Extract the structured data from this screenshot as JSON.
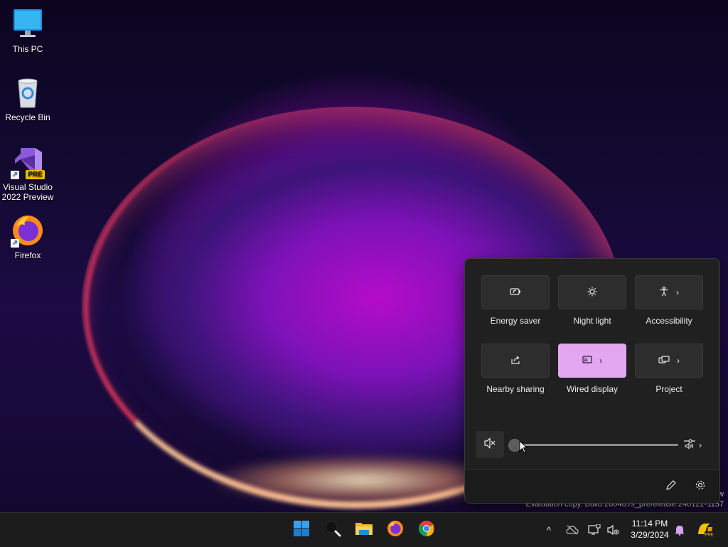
{
  "desktop": {
    "icons": [
      {
        "label": "This PC",
        "icon": "monitor-icon"
      },
      {
        "label": "Recycle Bin",
        "icon": "recycle-bin-icon"
      },
      {
        "label": "Visual Studio 2022 Preview",
        "icon": "visual-studio-icon",
        "badge": "PRE"
      },
      {
        "label": "Firefox",
        "icon": "firefox-icon"
      }
    ]
  },
  "watermark": {
    "line1": "w",
    "line2": "Evaluation copy. Build 26040.rs_prerelease.240122-1157"
  },
  "quick_settings": {
    "tiles": [
      {
        "label": "Energy saver",
        "icon": "energy-saver-icon",
        "active": false,
        "has_chevron": false
      },
      {
        "label": "Night light",
        "icon": "night-light-icon",
        "active": false,
        "has_chevron": false
      },
      {
        "label": "Accessibility",
        "icon": "accessibility-icon",
        "active": false,
        "has_chevron": true
      },
      {
        "label": "Nearby sharing",
        "icon": "nearby-sharing-icon",
        "active": false,
        "has_chevron": false
      },
      {
        "label": "Wired display",
        "icon": "cast-icon",
        "active": true,
        "has_chevron": true
      },
      {
        "label": "Project",
        "icon": "project-icon",
        "active": false,
        "has_chevron": true
      }
    ],
    "chevron": "›",
    "volume": {
      "level": 0,
      "muted": true
    },
    "accent_color": "#e3a6f0"
  },
  "taskbar": {
    "apps": [
      "start-icon",
      "search-icon",
      "file-explorer-icon",
      "firefox-icon",
      "chrome-icon"
    ],
    "tray": [
      "show-hidden-icons-icon",
      "onedrive-icon",
      "network-icon",
      "volume-muted-icon",
      "notification-bell-icon",
      "copilot-icon"
    ],
    "tray_chevron": "^",
    "clock": {
      "time": "11:14 PM",
      "date": "3/29/2024"
    }
  }
}
